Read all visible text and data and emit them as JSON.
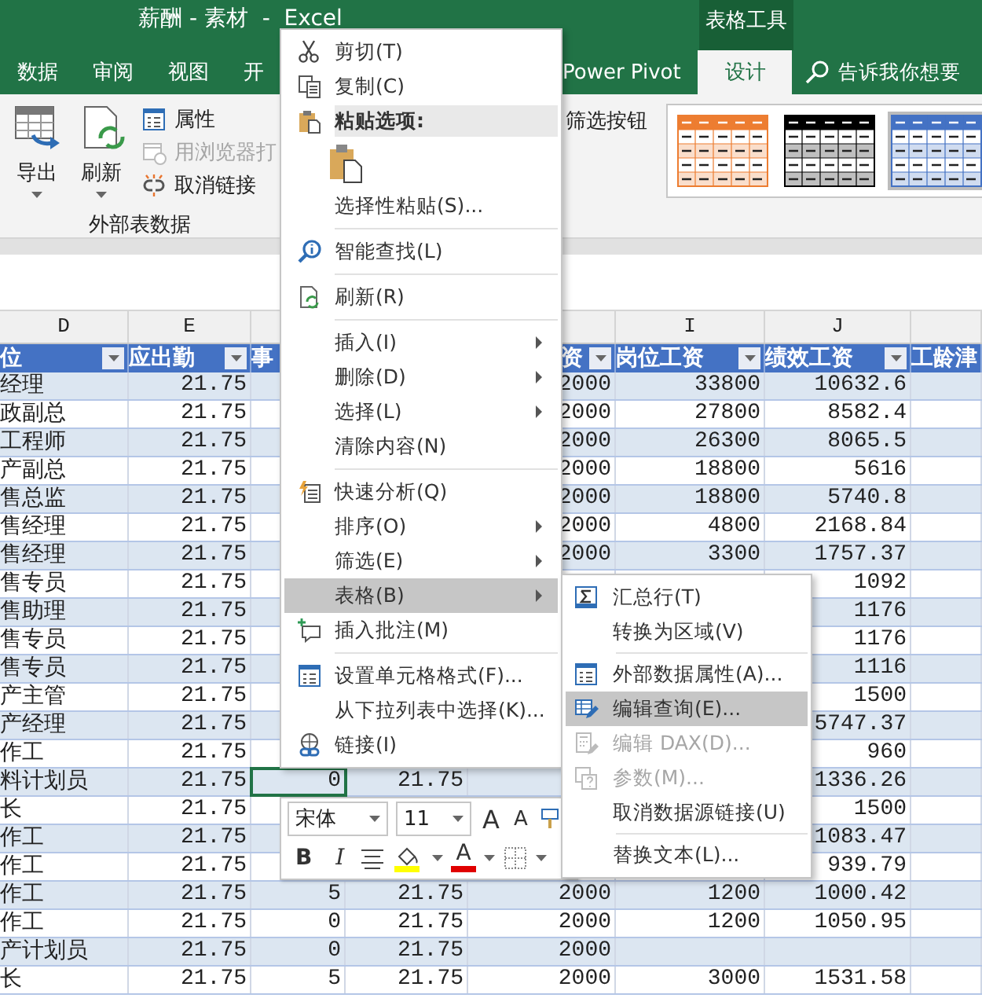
{
  "window": {
    "title": "薪酬 - 素材  -  Excel",
    "context_label": "表格工具"
  },
  "ribbon_tabs": [
    {
      "label": "数据",
      "selected": false
    },
    {
      "label": "审阅",
      "selected": false
    },
    {
      "label": "视图",
      "selected": false
    },
    {
      "label": "开",
      "selected": false
    },
    {
      "label": "Power Pivot",
      "selected": false
    },
    {
      "label": "设计",
      "selected": true
    }
  ],
  "search": {
    "placeholder": "告诉我你想要"
  },
  "ribbon": {
    "buttons": [
      {
        "label": "导出",
        "kind": "large",
        "disabled": false
      },
      {
        "label": "刷新",
        "kind": "large",
        "disabled": false
      },
      {
        "label": "属性",
        "kind": "small",
        "disabled": false
      },
      {
        "label": "用浏览器打",
        "kind": "small",
        "disabled": true
      },
      {
        "label": "取消链接",
        "kind": "small",
        "disabled": false
      }
    ],
    "group_label": "外部表数据",
    "option_label": "筛选按钮",
    "table_styles": [
      {
        "color": "#ed7d31",
        "selected": false
      },
      {
        "color": "#000000",
        "selected": false
      },
      {
        "color": "#4472c4",
        "selected": true
      }
    ]
  },
  "table": {
    "columns": [
      {
        "letter": "D",
        "header": "位",
        "filter": true
      },
      {
        "letter": "E",
        "header": "应出勤",
        "filter": true
      },
      {
        "header": "事"
      },
      {},
      {
        "header": "资",
        "filter": true
      },
      {
        "letter": "I",
        "header": "岗位工资",
        "filter": true
      },
      {
        "letter": "J",
        "header": "绩效工资",
        "filter": true
      },
      {
        "header": "工龄津",
        "filter": false
      }
    ],
    "rows": [
      {
        "cells": [
          "经理",
          "21.75",
          null,
          null,
          "2000",
          "33800",
          "10632.6",
          null
        ]
      },
      {
        "cells": [
          "政副总",
          "21.75",
          null,
          null,
          "2000",
          "27800",
          "8582.4",
          null
        ]
      },
      {
        "cells": [
          "工程师",
          "21.75",
          null,
          null,
          "2000",
          "26300",
          "8065.5",
          null
        ]
      },
      {
        "cells": [
          "产副总",
          "21.75",
          null,
          null,
          "2000",
          "18800",
          "5616",
          null
        ]
      },
      {
        "cells": [
          "售总监",
          "21.75",
          null,
          null,
          "2000",
          "18800",
          "5740.8",
          null
        ]
      },
      {
        "cells": [
          "售经理",
          "21.75",
          null,
          null,
          "2000",
          "4800",
          "2168.84",
          null
        ]
      },
      {
        "cells": [
          "售经理",
          "21.75",
          null,
          null,
          "2000",
          "3300",
          "1757.37",
          null
        ]
      },
      {
        "cells": [
          "售专员",
          "21.75",
          null,
          null,
          null,
          null,
          "1092",
          null
        ]
      },
      {
        "cells": [
          "售助理",
          "21.75",
          null,
          null,
          null,
          null,
          "1176",
          null
        ]
      },
      {
        "cells": [
          "售专员",
          "21.75",
          null,
          null,
          null,
          null,
          "1176",
          null
        ]
      },
      {
        "cells": [
          "售专员",
          "21.75",
          null,
          null,
          null,
          null,
          "1116",
          null
        ]
      },
      {
        "cells": [
          "产主管",
          "21.75",
          null,
          null,
          null,
          null,
          "1500",
          null
        ]
      },
      {
        "cells": [
          "产经理",
          "21.75",
          null,
          null,
          null,
          null,
          "5747.37",
          null
        ]
      },
      {
        "cells": [
          "作工",
          "21.75",
          null,
          null,
          null,
          null,
          "960",
          null
        ]
      },
      {
        "cells": [
          "料计划员",
          "21.75",
          {
            "text": "0",
            "active": true
          },
          "21.75",
          null,
          null,
          "1336.26",
          null
        ]
      },
      {
        "cells": [
          "长",
          "21.75",
          null,
          null,
          null,
          null,
          "1500",
          null
        ]
      },
      {
        "cells": [
          "作工",
          "21.75",
          null,
          null,
          null,
          null,
          "1083.47",
          null
        ]
      },
      {
        "cells": [
          "作工",
          "21.75",
          null,
          null,
          null,
          null,
          "939.79",
          null
        ]
      },
      {
        "cells": [
          "作工",
          "21.75",
          "5",
          "21.75",
          "2000",
          "1200",
          "1000.42",
          null
        ]
      },
      {
        "cells": [
          "作工",
          "21.75",
          "0",
          "21.75",
          "2000",
          "1200",
          "1050.95",
          null
        ]
      },
      {
        "cells": [
          "产计划员",
          "21.75",
          "0",
          "21.75",
          "2000",
          null,
          null,
          null
        ]
      },
      {
        "cells": [
          "长",
          "21.75",
          "5",
          "21.75",
          "2000",
          "3000",
          "1531.58",
          null
        ]
      }
    ]
  },
  "context_menu": {
    "items": [
      {
        "kind": "item",
        "label": "剪切(T)",
        "submenu": false,
        "highlighted": false
      },
      {
        "kind": "item",
        "label": "复制(C)",
        "submenu": false,
        "highlighted": false
      },
      {
        "kind": "header",
        "label": "粘贴选项:"
      },
      {
        "kind": "paste_options"
      },
      {
        "kind": "item",
        "label": "选择性粘贴(S)...",
        "submenu": false,
        "highlighted": false
      },
      {
        "kind": "separator"
      },
      {
        "kind": "item",
        "label": "智能查找(L)",
        "submenu": false,
        "highlighted": false
      },
      {
        "kind": "separator"
      },
      {
        "kind": "item",
        "label": "刷新(R)",
        "submenu": false,
        "highlighted": false
      },
      {
        "kind": "separator"
      },
      {
        "kind": "item",
        "label": "插入(I)",
        "submenu": true,
        "highlighted": false
      },
      {
        "kind": "item",
        "label": "删除(D)",
        "submenu": true,
        "highlighted": false
      },
      {
        "kind": "item",
        "label": "选择(L)",
        "submenu": true,
        "highlighted": false
      },
      {
        "kind": "item",
        "label": "清除内容(N)",
        "submenu": false,
        "highlighted": false
      },
      {
        "kind": "separator"
      },
      {
        "kind": "item",
        "label": "快速分析(Q)",
        "submenu": false,
        "highlighted": false
      },
      {
        "kind": "item",
        "label": "排序(O)",
        "submenu": true,
        "highlighted": false
      },
      {
        "kind": "item",
        "label": "筛选(E)",
        "submenu": true,
        "highlighted": false
      },
      {
        "kind": "item",
        "label": "表格(B)",
        "submenu": true,
        "highlighted": true
      },
      {
        "kind": "item",
        "label": "插入批注(M)",
        "submenu": false,
        "highlighted": false
      },
      {
        "kind": "separator"
      },
      {
        "kind": "item",
        "label": "设置单元格格式(F)...",
        "submenu": false,
        "highlighted": false
      },
      {
        "kind": "item",
        "label": "从下拉列表中选择(K)...",
        "submenu": false,
        "highlighted": false
      },
      {
        "kind": "item",
        "label": "链接(I)",
        "submenu": false,
        "highlighted": false
      }
    ]
  },
  "submenu": {
    "items": [
      {
        "kind": "item",
        "label": "汇总行(T)",
        "highlighted": false,
        "disabled": false
      },
      {
        "kind": "item",
        "label": "转换为区域(V)",
        "highlighted": false,
        "disabled": false
      },
      {
        "kind": "separator"
      },
      {
        "kind": "item",
        "label": "外部数据属性(A)...",
        "highlighted": false,
        "disabled": false
      },
      {
        "kind": "item",
        "label": "编辑查询(E)...",
        "highlighted": true,
        "disabled": false
      },
      {
        "kind": "item",
        "label": "编辑 DAX(D)...",
        "highlighted": false,
        "disabled": true
      },
      {
        "kind": "item",
        "label": "参数(M)...",
        "highlighted": false,
        "disabled": true
      },
      {
        "kind": "item",
        "label": "取消数据源链接(U)",
        "highlighted": false,
        "disabled": false
      },
      {
        "kind": "separator"
      },
      {
        "kind": "item",
        "label": "替换文本(L)...",
        "highlighted": false,
        "disabled": false
      }
    ]
  },
  "mini_toolbar": {
    "font": "宋体",
    "size": "11",
    "grow_label": "A",
    "shrink_label": "A",
    "bold_label": "B",
    "italic_label": "I",
    "font_color_label": "A"
  }
}
